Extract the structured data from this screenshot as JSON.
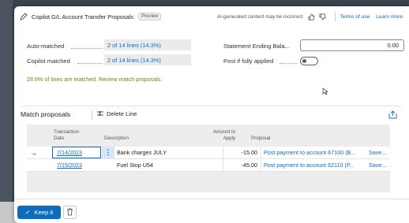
{
  "header": {
    "title": "Copilot G/L Account Transfer Proposals",
    "badge": "Preview",
    "disclaimer": "AI-generated content may be incorrect",
    "terms_link": "Terms of use",
    "learn_link": "Learn more"
  },
  "fields": {
    "auto_matched_label": "Auto-matched",
    "auto_matched_value": "2 of 14 lines (14.3%)",
    "copilot_matched_label": "Copilot matched",
    "copilot_matched_value": "2 of 14 lines (14.3%)",
    "info_text": "28.6% of lines are matched. Review match proposals.",
    "statement_label": "Statement Ending Bala...",
    "statement_value": "0.00",
    "post_label": "Post if fully applied",
    "post_toggle": false
  },
  "proposals": {
    "title": "Match proposals",
    "delete_line_label": "Delete Line",
    "columns": {
      "date_line1": "Transaction",
      "date_line2": "Date",
      "description": "Description",
      "amount_line1": "Amount to",
      "amount_line2": "Apply",
      "proposal": "Proposal"
    },
    "rows": [
      {
        "date": "7/14/2023",
        "description": "Bank charges JULY",
        "amount": "-15.00",
        "proposal": "Post payment to account 67100 (B...",
        "save": "Save..."
      },
      {
        "date": "7/15/2023",
        "description": "Fuel Stop U54",
        "amount": "-45.00",
        "proposal": "Post payment to account 62110 (P...",
        "save": "Save..."
      }
    ]
  },
  "footer": {
    "keep_label": "Keep it"
  },
  "colors": {
    "accent": "#0f6cbd",
    "info": "#8a7a0a"
  }
}
